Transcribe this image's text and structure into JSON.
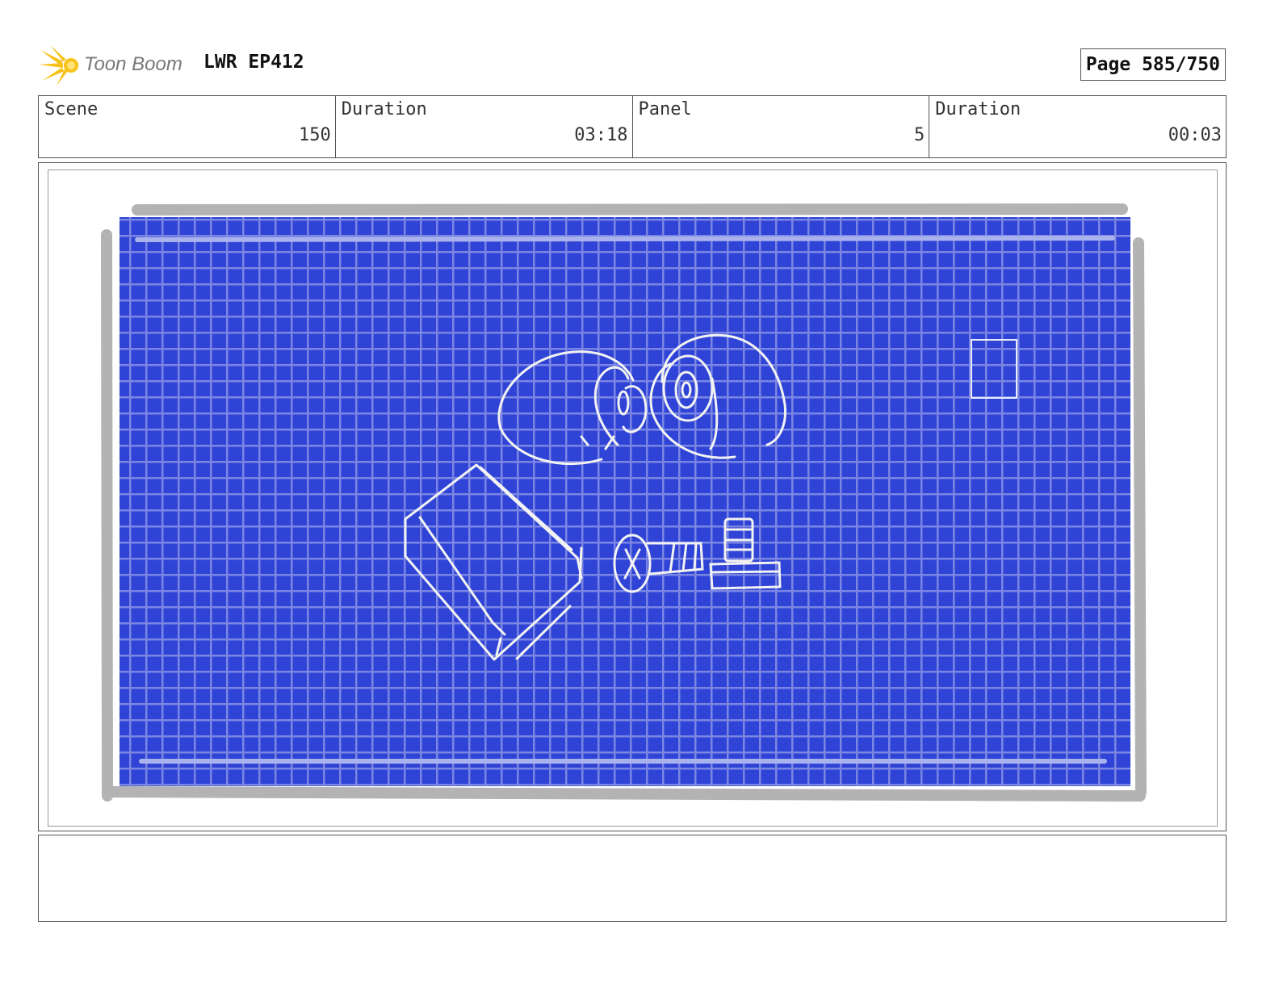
{
  "header": {
    "logo_icon": "toon-boom-starburst-icon",
    "logo_text": "Toon Boom",
    "project": "LWR EP412",
    "page_label": "Page 585/750"
  },
  "info": {
    "scene_label": "Scene",
    "scene_value": "150",
    "scene_duration_label": "Duration",
    "scene_duration_value": "03:18",
    "panel_label": "Panel",
    "panel_value": "5",
    "panel_duration_label": "Duration",
    "panel_duration_value": "00:03"
  },
  "colors": {
    "blueprint": "#2f44d6",
    "grid": "#7b86e3",
    "frame": "#b3b3b3",
    "sketch": "#f2f2f2",
    "logo_yellow": "#f7c21a"
  },
  "notes": {
    "text": ""
  }
}
